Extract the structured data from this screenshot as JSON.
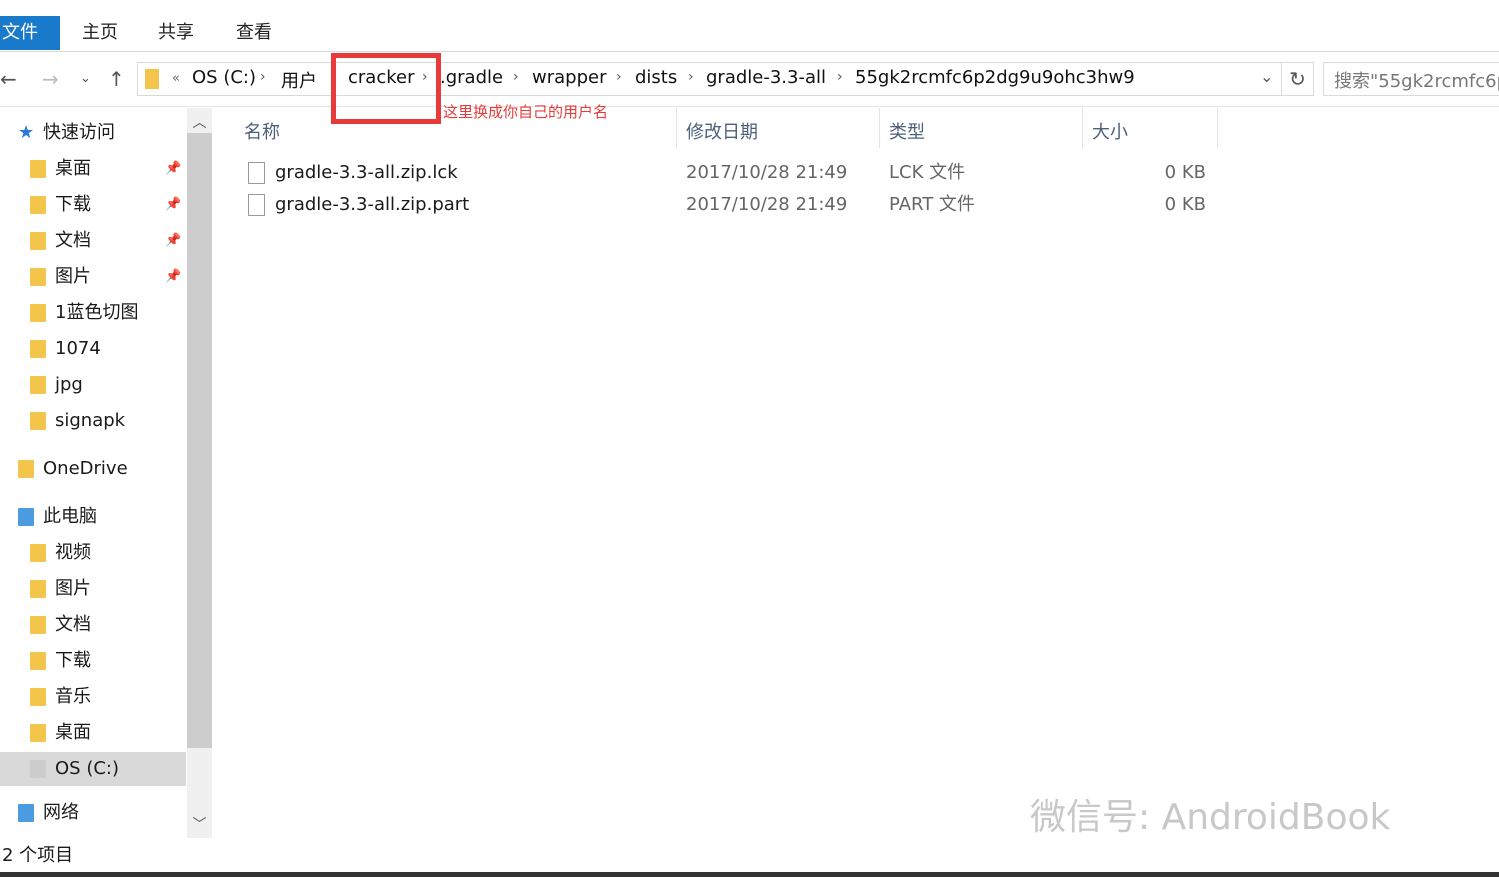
{
  "ribbon": {
    "tabs": [
      "文件",
      "主页",
      "共享",
      "查看"
    ]
  },
  "address": {
    "crumbs": [
      "OS (C:)",
      "用户",
      "cracker",
      ".gradle",
      "wrapper",
      "dists",
      "gradle-3.3-all",
      "55gk2rcmfc6p2dg9u9ohc3hw9"
    ],
    "overflow": "«"
  },
  "search": {
    "placeholder": "搜索\"55gk2rcmfc6p"
  },
  "annotation": {
    "text": "这里换成你自己的用户名",
    "color": "#e83a3a"
  },
  "sidebar": {
    "items": [
      {
        "label": "快速访问",
        "icon": "star-icon",
        "pinned": false
      },
      {
        "label": "桌面",
        "icon": "desktop-folder-icon",
        "pinned": true
      },
      {
        "label": "下载",
        "icon": "download-folder-icon",
        "pinned": true
      },
      {
        "label": "文档",
        "icon": "documents-folder-icon",
        "pinned": true
      },
      {
        "label": "图片",
        "icon": "pictures-folder-icon",
        "pinned": true
      },
      {
        "label": "1蓝色切图",
        "icon": "folder-icon",
        "pinned": false
      },
      {
        "label": "1074",
        "icon": "folder-icon",
        "pinned": false
      },
      {
        "label": "jpg",
        "icon": "folder-icon",
        "pinned": false
      },
      {
        "label": "signapk",
        "icon": "folder-icon",
        "pinned": false
      },
      {
        "label": "OneDrive",
        "icon": "onedrive-icon",
        "pinned": false
      },
      {
        "label": "此电脑",
        "icon": "computer-icon",
        "pinned": false
      },
      {
        "label": "视频",
        "icon": "videos-folder-icon",
        "pinned": false
      },
      {
        "label": "图片",
        "icon": "pictures-folder-icon",
        "pinned": false
      },
      {
        "label": "文档",
        "icon": "documents-folder-icon",
        "pinned": false
      },
      {
        "label": "下载",
        "icon": "download-folder-icon",
        "pinned": false
      },
      {
        "label": "音乐",
        "icon": "music-folder-icon",
        "pinned": false
      },
      {
        "label": "桌面",
        "icon": "desktop-folder-icon",
        "pinned": false
      },
      {
        "label": "OS (C:)",
        "icon": "drive-icon",
        "pinned": false,
        "selected": true
      },
      {
        "label": "网络",
        "icon": "network-icon",
        "pinned": false
      }
    ]
  },
  "columns": [
    "名称",
    "修改日期",
    "类型",
    "大小"
  ],
  "files": [
    {
      "name": "gradle-3.3-all.zip.lck",
      "date": "2017/10/28 21:49",
      "type": "LCK 文件",
      "size": "0 KB"
    },
    {
      "name": "gradle-3.3-all.zip.part",
      "date": "2017/10/28 21:49",
      "type": "PART 文件",
      "size": "0 KB"
    }
  ],
  "status": {
    "count": "2 个项目"
  },
  "watermark": "微信号: AndroidBook",
  "colors": {
    "accent": "#1979ca",
    "highlight": "#e83a3a"
  }
}
